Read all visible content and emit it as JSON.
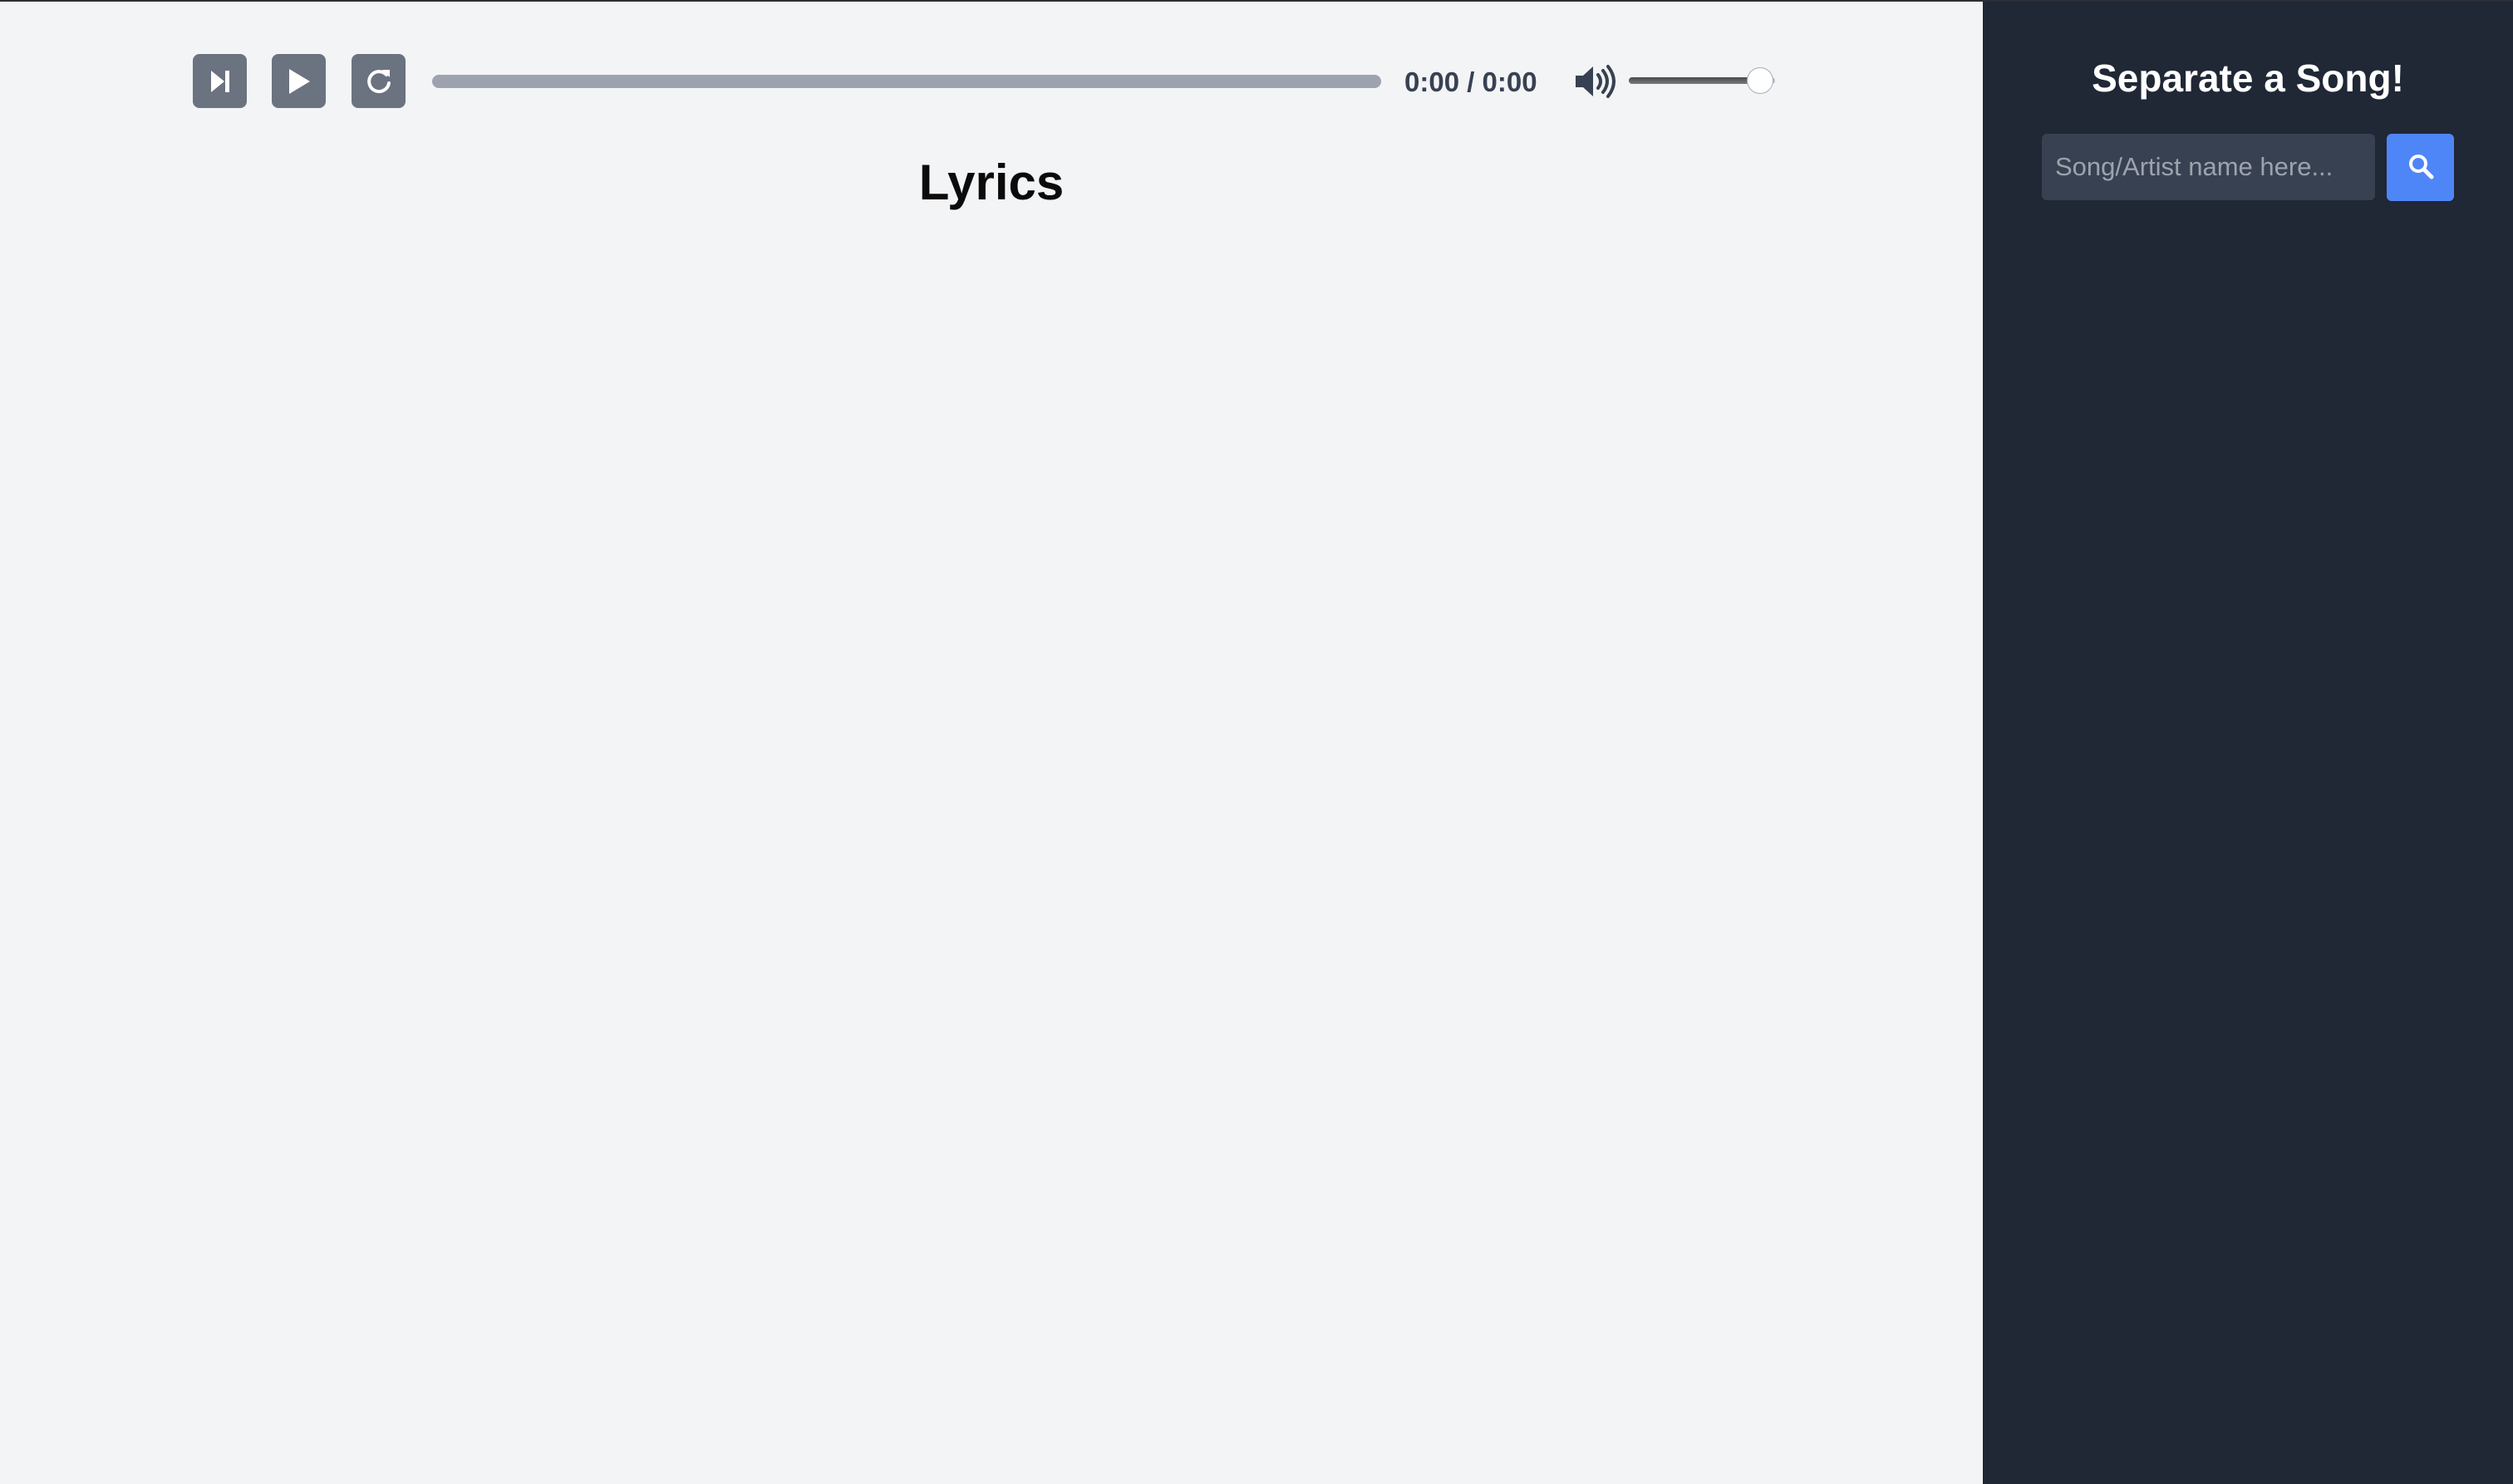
{
  "player": {
    "buttons": [
      {
        "name": "skip-button",
        "icon": "skip-forward-icon"
      },
      {
        "name": "play-button",
        "icon": "play-icon"
      },
      {
        "name": "reload-button",
        "icon": "reload-icon"
      }
    ],
    "progress_fraction": 0,
    "time_text": "0:00 / 0:00",
    "volume_icon": "volume-icon",
    "volume_fraction": 0.9
  },
  "main": {
    "title": "Lyrics"
  },
  "sidebar": {
    "title": "Separate a Song!",
    "search_placeholder": "Song/Artist name here...",
    "search_value": "",
    "search_button_icon": "search-icon"
  },
  "colors": {
    "main_bg": "#f3f4f6",
    "sidebar_bg": "#202735",
    "control_button": "#6b7280",
    "progress_track": "#9ca3af",
    "search_button": "#4f86f7",
    "search_input_bg": "#374151"
  }
}
